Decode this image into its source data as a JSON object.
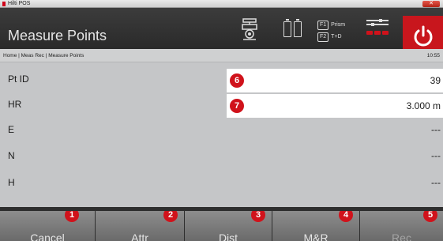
{
  "window": {
    "app_title": "Hilti POS",
    "close_symbol": "✕"
  },
  "header": {
    "title": "Measure Points",
    "fkeys": [
      {
        "key": "F1",
        "label": "Prism"
      },
      {
        "key": "F2",
        "label": "T+D"
      }
    ],
    "icons": [
      "prism-icon",
      "battery-icon",
      "settings-icon",
      "power-icon"
    ]
  },
  "breadcrumb": {
    "path": "Home | Meas Rec | Measure Points",
    "time": "10:55"
  },
  "fields": [
    {
      "label": "Pt ID",
      "value": "39",
      "badge": "6"
    },
    {
      "label": "HR",
      "value": "3.000 m",
      "badge": "7"
    },
    {
      "label": "E",
      "value": "---"
    },
    {
      "label": "N",
      "value": "---"
    },
    {
      "label": "H",
      "value": "---"
    }
  ],
  "softkeys": [
    {
      "label": "Cancel",
      "badge": "1"
    },
    {
      "label": "Attr",
      "badge": "2"
    },
    {
      "label": "Dist",
      "badge": "3"
    },
    {
      "label": "M&R",
      "badge": "4"
    },
    {
      "label": "Rec",
      "badge": "5",
      "disabled": true
    }
  ],
  "colors": {
    "accent": "#d0121b",
    "header_bg": "#333333",
    "content_bg": "#c5c6c8",
    "softkey_bg": "#7a7a7a"
  }
}
